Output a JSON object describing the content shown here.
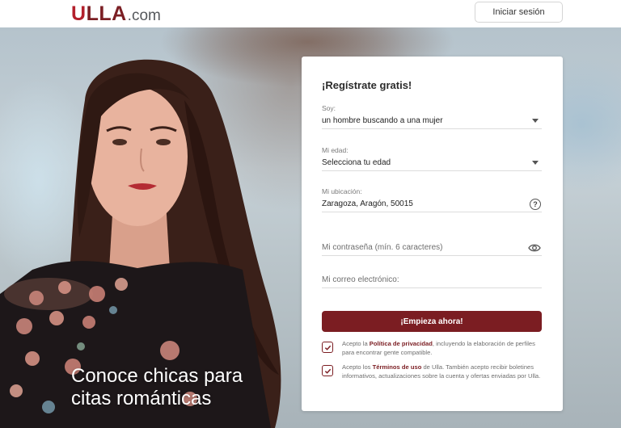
{
  "header": {
    "logo_brand": "ULLA",
    "logo_tld": ".com",
    "login_label": "Iniciar sesión"
  },
  "hero": {
    "tagline": "Conoce chicas para citas románticas"
  },
  "form": {
    "title": "¡Regístrate gratis!",
    "soy_label": "Soy:",
    "soy_value": "un hombre buscando a una mujer",
    "edad_label": "Mi edad:",
    "edad_value": "Selecciona tu edad",
    "ubicacion_label": "Mi ubicación:",
    "ubicacion_value": "Zaragoza, Aragón, 50015",
    "password_placeholder": "Mi contraseña (mín. 6 caracteres)",
    "email_placeholder": "Mi correo electrónico:",
    "submit_label": "¡Empieza ahora!",
    "consent_privacy": {
      "pre": "Acepto la ",
      "link": "Política de privacidad",
      "post": ", incluyendo la elaboración de perfiles para encontrar gente compatible.",
      "checked": true
    },
    "consent_terms": {
      "pre": "Acepto los ",
      "link": "Términos de uso",
      "post": " de Ulla. También acepto recibir boletines informativos, actualizaciones sobre la cuenta y ofertas enviadas por Ulla.",
      "checked": true
    }
  },
  "colors": {
    "brand": "#7b1d22",
    "logo_u": "#b3202c"
  },
  "icons": [
    "help-icon",
    "eye-icon",
    "check-icon",
    "caret-down-icon"
  ]
}
